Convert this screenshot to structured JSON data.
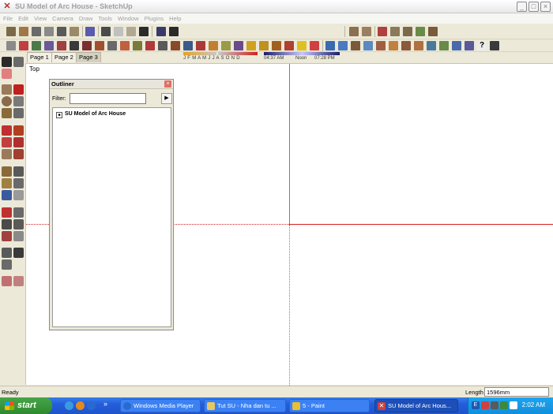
{
  "window": {
    "title": "SU Model of Arc House - SketchUp",
    "minimize": "_",
    "maximize": "□",
    "close": "×"
  },
  "menu": [
    "File",
    "Edit",
    "View",
    "Camera",
    "Draw",
    "Tools",
    "Window",
    "Plugins",
    "Help"
  ],
  "shadows": {
    "months": "J F M A M J J A S O N D",
    "time_start": "04:37 AM",
    "time_noon": "Noon",
    "time_end": "07:28 PM"
  },
  "tabs": [
    {
      "label": "Page 1",
      "active": false
    },
    {
      "label": "Page 2",
      "active": false
    },
    {
      "label": "Page 3",
      "active": true
    }
  ],
  "viewport": {
    "view_label": "Top",
    "colors": {
      "green_axis": "#2db82d",
      "red_axis": "#d62020"
    }
  },
  "outliner": {
    "title": "Outliner",
    "filter_label": "Filter:",
    "filter_value": "",
    "item": "SU Model of Arc House"
  },
  "status": {
    "text": "Ready",
    "length_label": "Length",
    "length_value": "1596mm"
  },
  "taskbar": {
    "start": "start",
    "more": "»",
    "tasks": [
      {
        "label": "Windows Media Player",
        "active": false
      },
      {
        "label": "Tut SU - Nha dan tu ...",
        "active": false
      },
      {
        "label": "5 - Paint",
        "active": false
      },
      {
        "label": "SU Model of Arc Hous...",
        "active": true
      }
    ],
    "lang": "E",
    "clock": "2:02 AM"
  }
}
